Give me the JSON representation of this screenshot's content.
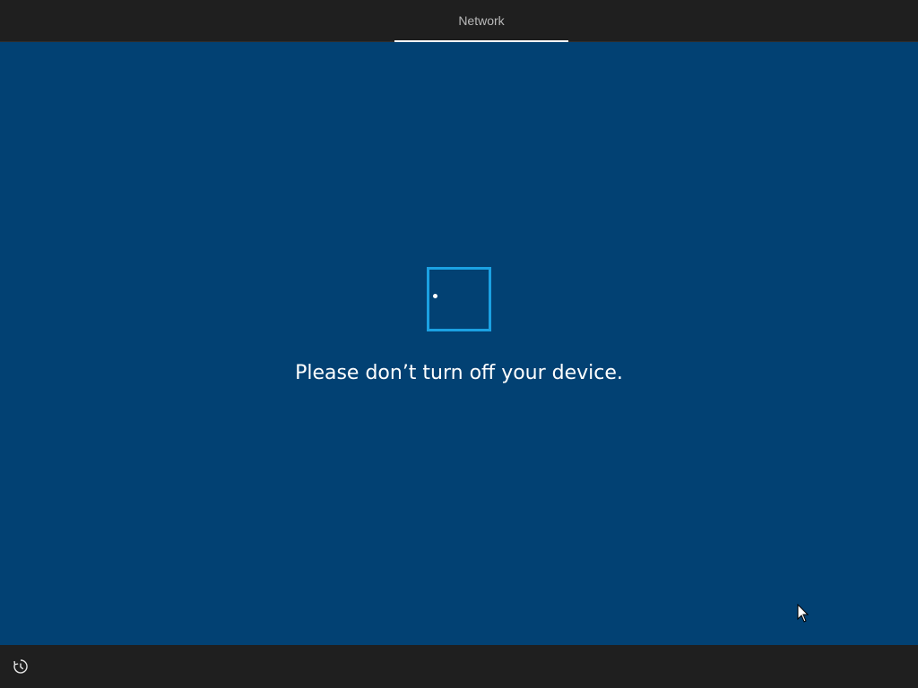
{
  "header": {
    "step_label": "Network"
  },
  "main": {
    "status_message": "Please don’t turn off your device."
  },
  "footer": {
    "accessibility_icon": "ease-of-access-icon"
  },
  "colors": {
    "background": "#024173",
    "bar": "#1f1f1f",
    "spinner": "#1ba1e2",
    "text": "#ffffff"
  }
}
